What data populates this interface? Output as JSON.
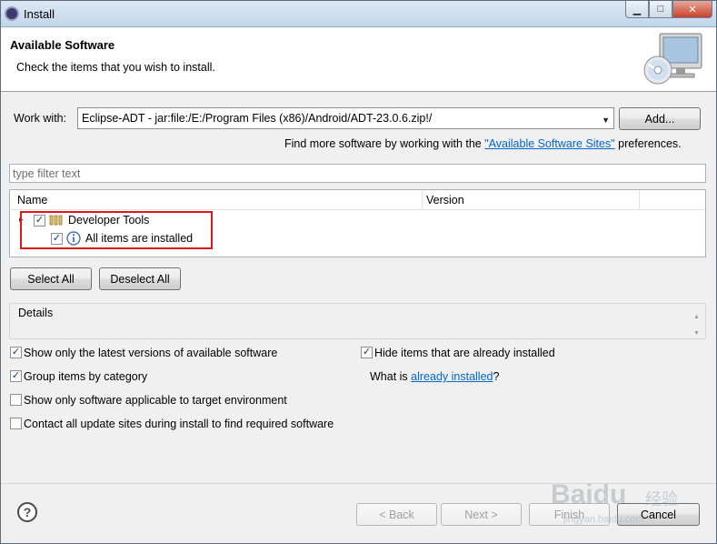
{
  "window": {
    "title": "Install",
    "buttons": {
      "minimize": "▁",
      "maximize": "□",
      "close": "✕"
    }
  },
  "header": {
    "title": "Available Software",
    "description": "Check the items that you wish to install."
  },
  "work_with": {
    "label": "Work with:",
    "value": "Eclipse-ADT - jar:file:/E:/Program Files (x86)/Android/ADT-23.0.6.zip!/",
    "add_button": "Add...",
    "hint_prefix": "Find more software by working with the ",
    "hint_link": "\"Available Software Sites\"",
    "hint_suffix": " preferences."
  },
  "filter": {
    "placeholder": "type filter text"
  },
  "tree": {
    "columns": [
      "Name",
      "Version"
    ],
    "items": [
      {
        "label": "Developer Tools",
        "checked": true,
        "icon": "package-icon",
        "expander": "▸"
      },
      {
        "label": "All items are installed",
        "checked": true,
        "icon": "info-icon"
      }
    ]
  },
  "actions": {
    "select_all": "Select All",
    "deselect_all": "Deselect All"
  },
  "details": {
    "label": "Details",
    "scroll_up": "▲",
    "scroll_down": "▼"
  },
  "options": [
    {
      "label": "Show only the latest versions of available software",
      "checked": true
    },
    {
      "label": "Group items by category",
      "checked": true
    },
    {
      "label": "Show only software applicable to target environment",
      "checked": false
    },
    {
      "label": "Contact all update sites during install to find required software",
      "checked": false
    },
    {
      "label": "Hide items that are already installed",
      "checked": true
    }
  ],
  "already_installed": {
    "prefix": "What is ",
    "link": "already installed",
    "suffix": "?"
  },
  "footer": {
    "help": "?",
    "back": "< Back",
    "next": "Next >",
    "finish": "Finish",
    "cancel": "Cancel"
  },
  "watermark": {
    "brand": "Baidu",
    "suffix": "经验",
    "url": "jingyan.baidu.com"
  },
  "colors": {
    "link": "#0066cc",
    "highlight": "#e0161b",
    "title_bar": "#c2d6ea"
  }
}
